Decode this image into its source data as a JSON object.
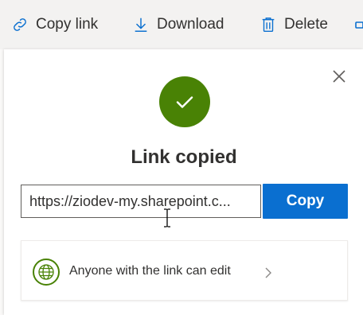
{
  "toolbar": {
    "copy_link": {
      "label": "Copy link",
      "icon": "link-icon"
    },
    "download": {
      "label": "Download",
      "icon": "download-icon"
    },
    "delete": {
      "label": "Delete",
      "icon": "trash-icon"
    }
  },
  "dialog": {
    "title": "Link copied",
    "link_value": "https://ziodev-my.sharepoint.c...",
    "copy_button_label": "Copy",
    "permission_text": "Anyone with the link can edit"
  },
  "colors": {
    "success": "#498205",
    "accent": "#0a6fd0",
    "toolbar_icon": "#0a6fd0"
  }
}
